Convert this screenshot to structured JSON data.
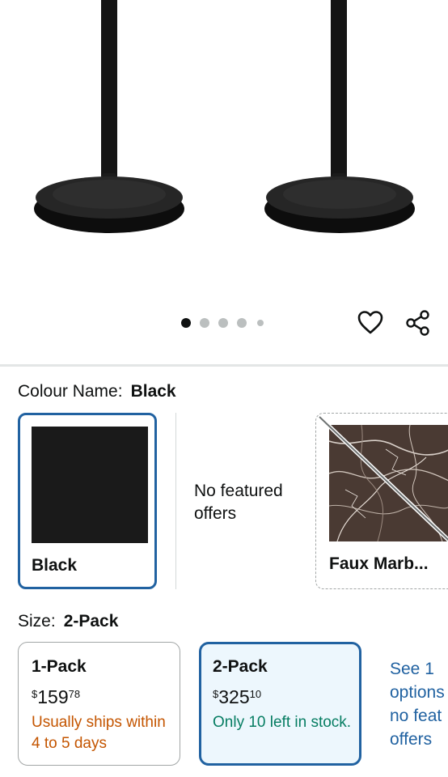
{
  "gallery": {
    "dots_total": 5,
    "dots_active_index": 0,
    "icons": [
      "heart-icon",
      "share-icon"
    ]
  },
  "colour": {
    "label": "Colour Name:",
    "selected": "Black",
    "options": [
      {
        "name": "Black",
        "swatch_color": "#1a1a1a",
        "state": "selected"
      },
      {
        "name": "No featured offers",
        "state": "unavailable"
      },
      {
        "name": "Faux Marb...",
        "state": "unavailable"
      }
    ]
  },
  "size": {
    "label": "Size:",
    "selected": "2-Pack",
    "options": [
      {
        "title": "1-Pack",
        "price_symbol": "$",
        "price_whole": "159",
        "price_fraction": "78",
        "shipping": "Usually ships within 4 to 5 days",
        "state": "available"
      },
      {
        "title": "2-Pack",
        "price_symbol": "$",
        "price_whole": "325",
        "price_fraction": "10",
        "shipping": "Only 10 left in stock.",
        "state": "selected"
      }
    ],
    "see_more": "See 1 options no feat offers"
  },
  "colors": {
    "accent": "#2162a1",
    "selected_bg": "#edf7fd",
    "shipping_orange": "#c45500",
    "stock_green": "#067d62"
  }
}
